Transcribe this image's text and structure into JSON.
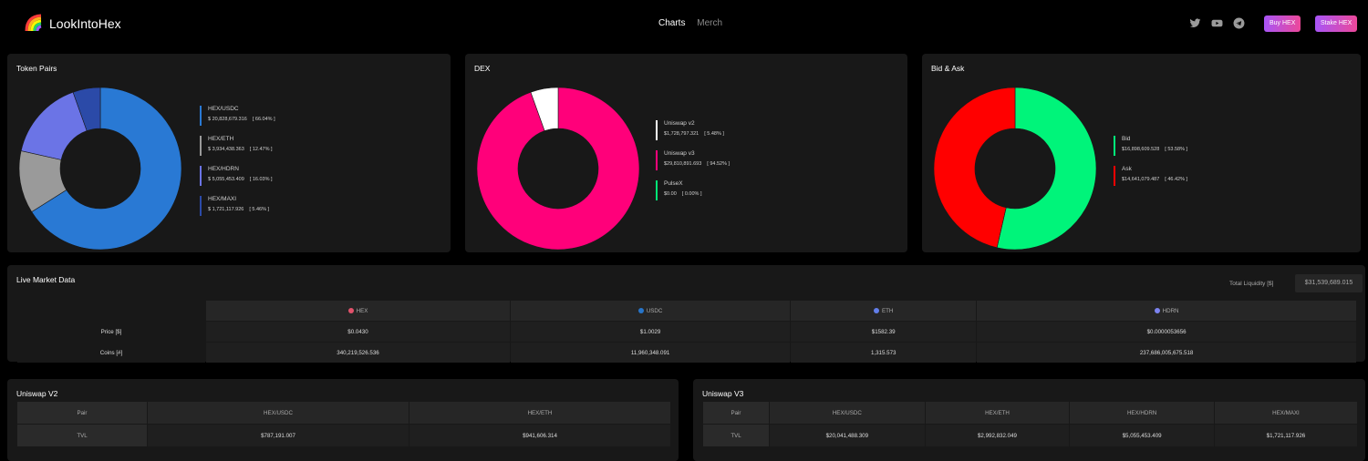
{
  "header": {
    "brand": "LookIntoHex",
    "nav": [
      "Charts",
      "Merch"
    ],
    "social_icons": [
      "twitter-icon",
      "youtube-icon",
      "telegram-icon"
    ],
    "buy_label": "Buy HEX",
    "stake_label": "Stake HEX"
  },
  "token_pairs": {
    "title": "Token Pairs",
    "items": [
      {
        "name": "HEX/USDC",
        "value": "$ 20,828,679.316",
        "pct": "[ 66.04% ]",
        "share": 66.04,
        "color": "#2979d4"
      },
      {
        "name": "HEX/ETH",
        "value": "$ 3,934,438.363",
        "pct": "[ 12.47% ]",
        "share": 12.47,
        "color": "#9a9a9a"
      },
      {
        "name": "HEX/HDRN",
        "value": "$ 5,055,453.409",
        "pct": "[ 16.03% ]",
        "share": 16.03,
        "color": "#6b74e6"
      },
      {
        "name": "HEX/MAXI",
        "value": "$ 1,721,117.926",
        "pct": "[ 5.46% ]",
        "share": 5.46,
        "color": "#2b4aa8"
      }
    ]
  },
  "dex": {
    "title": "DEX",
    "items": [
      {
        "name": "Uniswap v2",
        "value": "$1,728,797.321",
        "pct": "[ 5.48% ]",
        "share": 5.48,
        "color": "#ffffff"
      },
      {
        "name": "Uniswap v3",
        "value": "$29,810,891.693",
        "pct": "[ 94.52% ]",
        "share": 94.52,
        "color": "#ff007a"
      },
      {
        "name": "PulseX",
        "value": "$0.00",
        "pct": "[ 0.00% ]",
        "share": 0,
        "color": "#00e676"
      }
    ]
  },
  "bid_ask": {
    "title": "Bid & Ask",
    "items": [
      {
        "name": "Bid",
        "value": "$16,898,609.528",
        "pct": "[ 53.58% ]",
        "share": 53.58,
        "color": "#00f47a"
      },
      {
        "name": "Ask",
        "value": "$14,641,079.487",
        "pct": "[ 46.42% ]",
        "share": 46.42,
        "color": "#ff0000"
      }
    ]
  },
  "market": {
    "title": "Live Market Data",
    "liquidity_label": "Total Liquidity [$]",
    "liquidity_value": "$31,539,689.015",
    "columns": [
      {
        "name": "HEX",
        "color": "#e2526b"
      },
      {
        "name": "USDC",
        "color": "#2775ca"
      },
      {
        "name": "ETH",
        "color": "#627eea"
      },
      {
        "name": "HDRN",
        "color": "#7c83f0"
      }
    ],
    "rows": [
      {
        "label": "Price [$]",
        "values": [
          "$0.0430",
          "$1.0029",
          "$1582.39",
          "$0.0000053656"
        ]
      },
      {
        "label": "Coins [#]",
        "values": [
          "340,219,526.536",
          "11,960,348.091",
          "1,315.573",
          "237,686,005,675.518"
        ]
      }
    ]
  },
  "uniswap_v2": {
    "title": "Uniswap V2",
    "headers": [
      "Pair",
      "HEX/USDC",
      "HEX/ETH"
    ],
    "row": [
      "TVL",
      "$787,191.007",
      "$941,606.314"
    ]
  },
  "uniswap_v3": {
    "title": "Uniswap V3",
    "headers": [
      "Pair",
      "HEX/USDC",
      "HEX/ETH",
      "HEX/HDRN",
      "HEX/MAXI"
    ],
    "row": [
      "TVL",
      "$20,041,488.309",
      "$2,992,832.049",
      "$5,055,453.409",
      "$1,721,117.926"
    ]
  }
}
